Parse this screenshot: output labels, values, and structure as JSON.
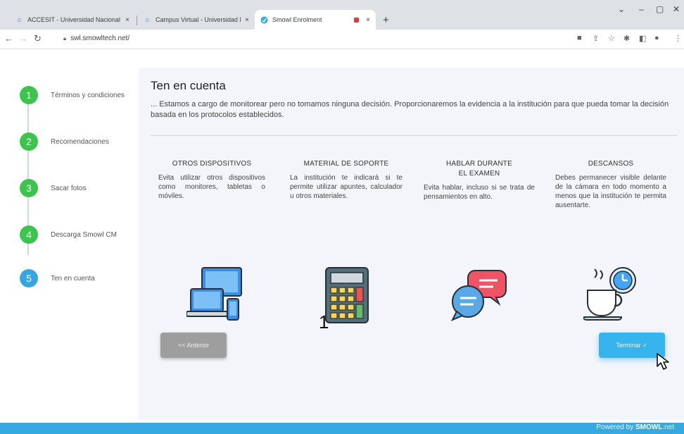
{
  "browser": {
    "tabs": [
      {
        "title": "ACCESIT - Universidad Nacional",
        "close": "×",
        "favicon": "university-icon"
      },
      {
        "title": "Campus Virtual - Universidad Na",
        "close": "×",
        "favicon": "university-icon"
      },
      {
        "title": "Smowl Enrolment",
        "close": "×",
        "favicon": "smowl-icon"
      }
    ],
    "new_tab": "+",
    "url": "swl.smowltech.net/"
  },
  "steps": [
    {
      "num": "1",
      "label": "Términos y condiciones",
      "state": "done",
      "color": "#3cc44e"
    },
    {
      "num": "2",
      "label": "Recomendaciones",
      "state": "done",
      "color": "#3cc44e"
    },
    {
      "num": "3",
      "label": "Sacar fotos",
      "state": "done",
      "color": "#3cc44e"
    },
    {
      "num": "4",
      "label": "Descarga Smowl CM",
      "state": "done",
      "color": "#3cc44e"
    },
    {
      "num": "5",
      "label": "Ten en cuenta",
      "state": "active",
      "color": "#36a5e0"
    }
  ],
  "main": {
    "title": "Ten en cuenta",
    "intro": "... Estamos a cargo de monitorear pero no tomamos ninguna decisión. Proporcionaremos la evidencia a la institución para que pueda tomar la decisión basada en los protocolos establecidos.",
    "columns": [
      {
        "heading": "OTROS DISPOSITIVOS",
        "body": "Evita utilizar otros dispositivos como monitores, tabletas o móviles.",
        "icon": "devices-icon"
      },
      {
        "heading": "MATERIAL DE SOPORTE",
        "body": "La institución te indicará si te permite utilizar apuntes, calculador u otros materiales.",
        "icon": "calculator-icon"
      },
      {
        "heading": "HABLAR DURANTE EL EXAMEN",
        "body": "Evita hablar, incluso si se trata de pensamientos en alto.",
        "icon": "chat-bubbles-icon"
      },
      {
        "heading": "DESCANSOS",
        "body": "Debes permanecer visible delante de la cámara en todo momento a menos que la institución te permita ausentarte.",
        "icon": "coffee-clock-icon"
      }
    ],
    "prev_button": "<< Anterior",
    "finish_button": "Terminar ✓",
    "annotation": "1"
  },
  "footer": {
    "powered_by": "Powered by ",
    "brand": "SMOWL",
    "suffix": ".net"
  },
  "colors": {
    "accent": "#36a9e1",
    "done": "#3cc44e",
    "active": "#36a5e0"
  }
}
